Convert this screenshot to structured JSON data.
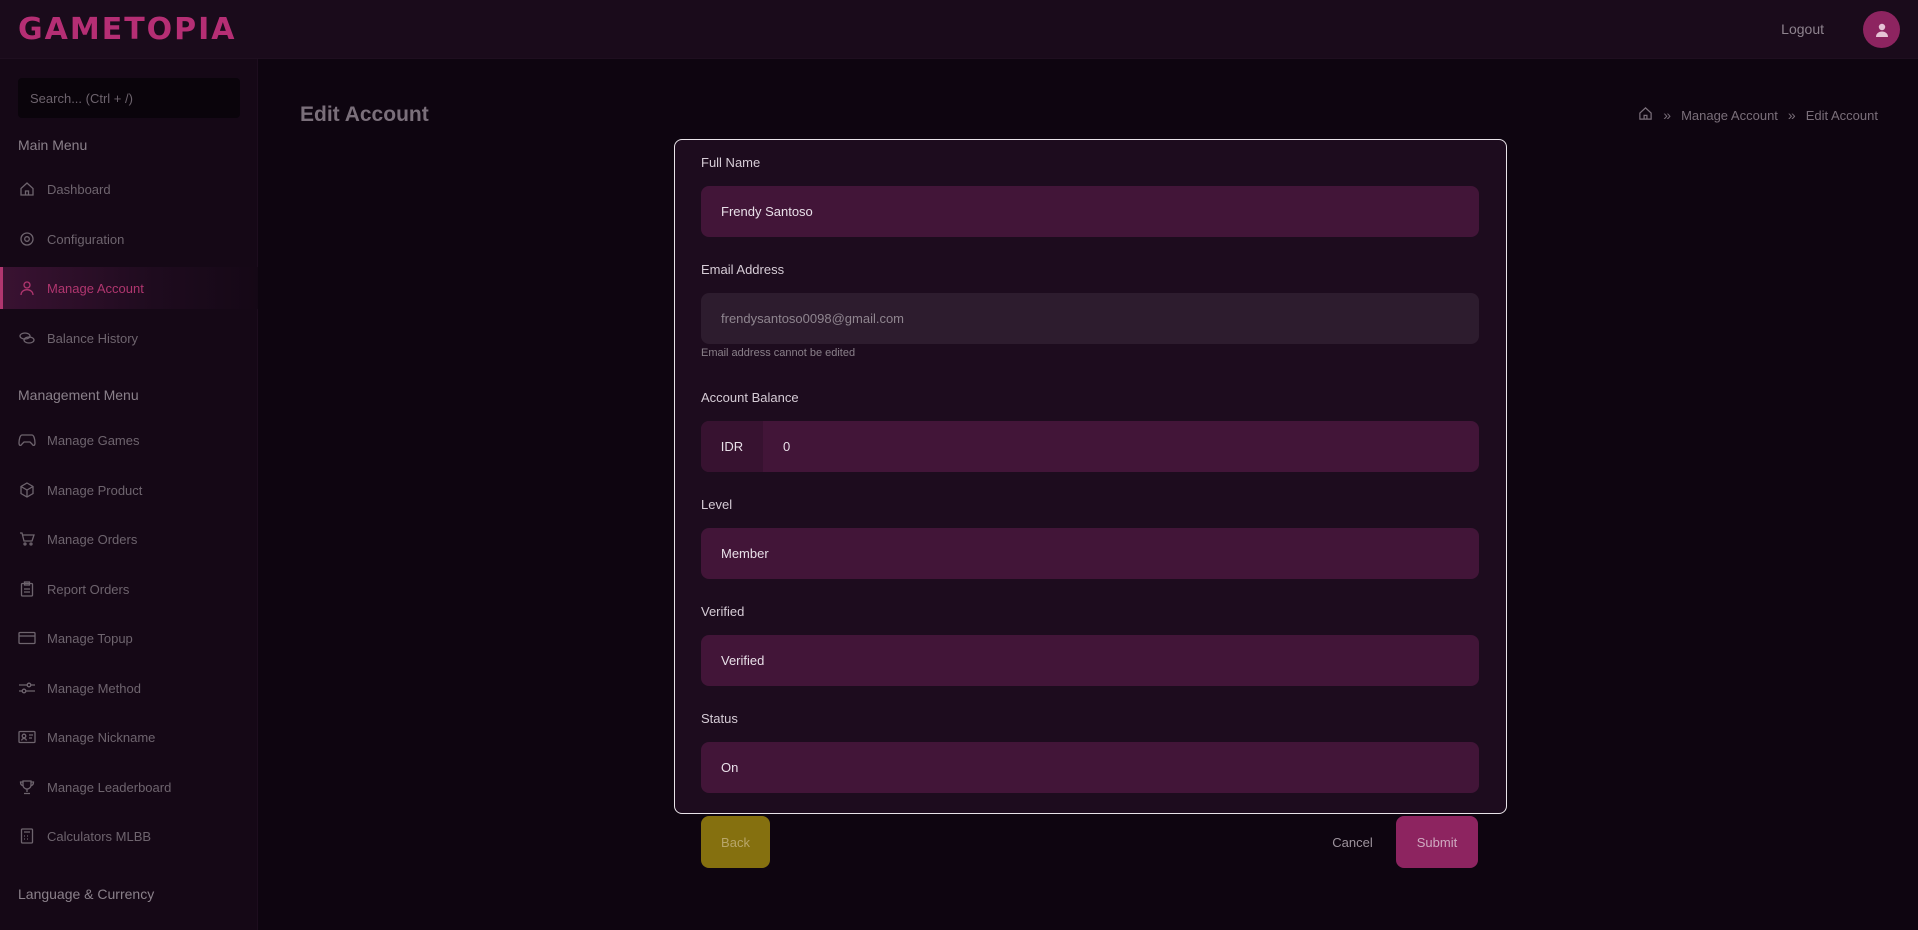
{
  "app": {
    "logo": "GAMETOPIA",
    "logout_label": "Logout"
  },
  "search": {
    "placeholder": "Search... (Ctrl + /)"
  },
  "sidebar": {
    "main_menu_title": "Main Menu",
    "main_items": [
      {
        "label": "Dashboard",
        "icon": "home-icon"
      },
      {
        "label": "Configuration",
        "icon": "gear-icon"
      },
      {
        "label": "Manage Account",
        "icon": "user-icon",
        "active": true
      },
      {
        "label": "Balance History",
        "icon": "coins-icon"
      }
    ],
    "management_menu_title": "Management Menu",
    "management_items": [
      {
        "label": "Manage Games",
        "icon": "gamepad-icon"
      },
      {
        "label": "Manage Product",
        "icon": "box-icon"
      },
      {
        "label": "Manage Orders",
        "icon": "cart-icon"
      },
      {
        "label": "Report Orders",
        "icon": "clipboard-icon"
      },
      {
        "label": "Manage Topup",
        "icon": "card-icon"
      },
      {
        "label": "Manage Method",
        "icon": "sliders-icon"
      },
      {
        "label": "Manage Nickname",
        "icon": "id-card-icon"
      },
      {
        "label": "Manage Leaderboard",
        "icon": "trophy-icon"
      },
      {
        "label": "Calculators MLBB",
        "icon": "calculator-icon"
      }
    ],
    "language_title": "Language & Currency"
  },
  "page": {
    "title": "Edit Account",
    "breadcrumb": [
      "Manage Account",
      "Edit Account"
    ]
  },
  "form": {
    "full_name_label": "Full Name",
    "full_name_value": "Frendy Santoso",
    "email_label": "Email Address",
    "email_value": "frendysantoso0098@gmail.com",
    "email_hint": "Email address cannot be edited",
    "balance_label": "Account Balance",
    "balance_currency": "IDR",
    "balance_value": "0",
    "level_label": "Level",
    "level_value": "Member",
    "verified_label": "Verified",
    "verified_value": "Verified",
    "status_label": "Status",
    "status_value": "On"
  },
  "actions": {
    "back": "Back",
    "cancel": "Cancel",
    "submit": "Submit"
  },
  "colors": {
    "accent": "#b52e74",
    "field_bg": "#421538",
    "back_button": "#85700f",
    "submit_button": "#8d2460"
  }
}
